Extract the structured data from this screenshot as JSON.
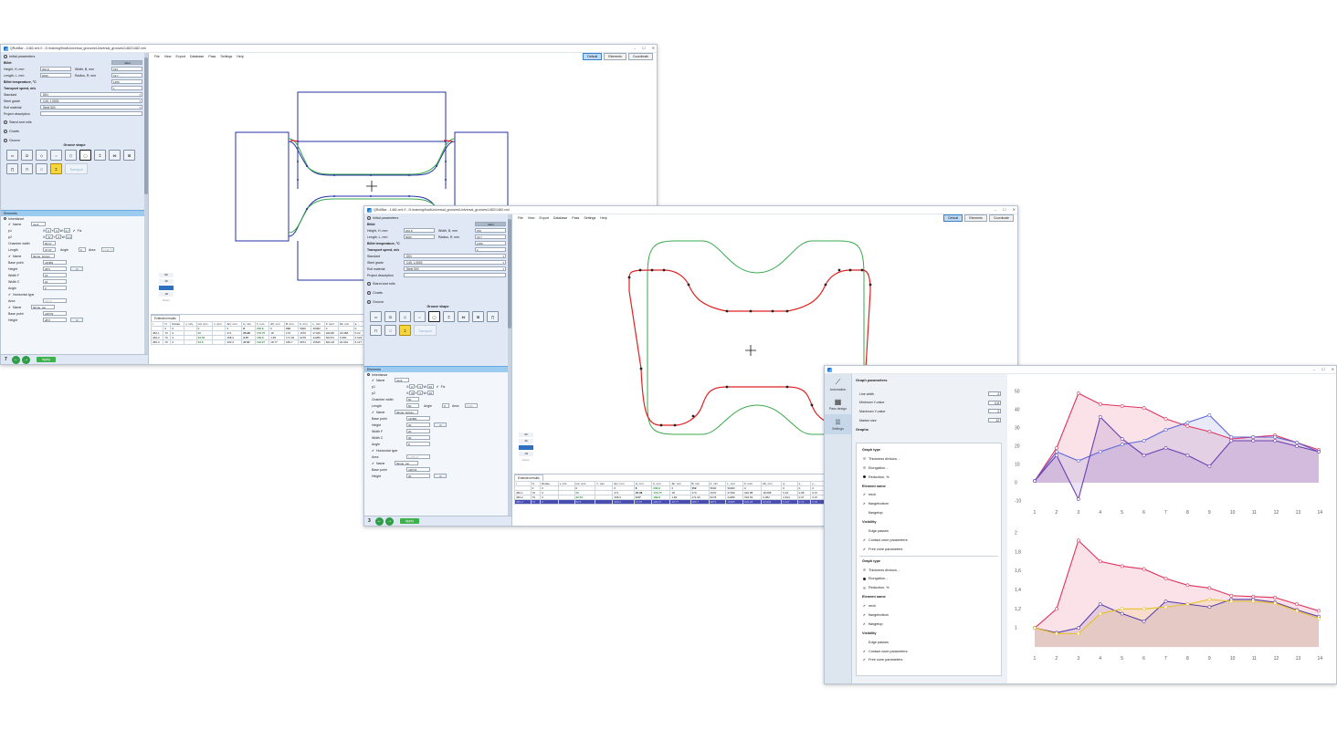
{
  "win1": {
    "title": "QRollBar - 1482.xml 0 - D:\\training\\final\\Universal_grooves\\Universal_grooves\\1482\\1482.xml",
    "menu": [
      "File",
      "View",
      "Export",
      "Database",
      "Pass",
      "Settings",
      "Help"
    ],
    "toolbar": [
      "Default",
      "Elements",
      "Coordinate"
    ],
    "initial": "Initial parameters",
    "billet": "Billet",
    "billet_tag": "label",
    "height_lbl": "Height, H, mm",
    "height_val": "202.8",
    "width_lbl": "Width, B, mm",
    "width_val": "152",
    "length_lbl": "Length, L, mm",
    "length_val": "5000",
    "radius_lbl": "Radius, R, mm",
    "radius_val": "19.7",
    "temp_lbl": "Billet temperature, °C",
    "temp_val": "1250",
    "speed_lbl": "Transport speed, m/s",
    "speed_val": "1",
    "standard_lbl": "Standard",
    "standard_val": "DIN",
    "steel_lbl": "Steel grade",
    "steel_val": "C45, 1.0503",
    "roll_lbl": "Roll material",
    "roll_val": "Steel 500",
    "desc_lbl": "Project description",
    "stand": "Stand and rolls",
    "charts": "Charts",
    "groove": "Groove",
    "groove_shape": "Groove shape",
    "transport": "Transport",
    "elements": "Elements",
    "inheritance": "Inheritance",
    "el_name_lbl": "Name",
    "el_name_val": "neck",
    "p1": "p1",
    "p2": "p2",
    "fix": "Fix",
    "chamber": "Chamber width",
    "chamber_val": "84.67",
    "len_lbl": "Length",
    "len_val": "37.97",
    "angle_lbl": "Angle",
    "area_lbl": "Area",
    "area_val": "1136.77",
    "el2_name": "flange_bottom",
    "base_lbl": "Base point",
    "base_val": "p2NB3",
    "height2_lbl": "Height",
    "height2_val": "28.5",
    "wf_lbl": "Width F",
    "wf_val": "15",
    "wc_lbl": "Width C",
    "wc_val": "22",
    "angle2_lbl": "Angle",
    "angle2_val": "0",
    "htype": "Horizontal type",
    "area2_lbl": "Area",
    "area2_val": "721.3",
    "el3_name": "flange_top",
    "base3_val": "p2PO3",
    "height3_val": "28.5",
    "c_btn": "C",
    "pass_no": "7",
    "apply": "Apply",
    "zoom": [
      "80",
      "40",
      "",
      "-40"
    ],
    "zoom_lbl": "Zoom",
    "results_tab": "Extended results",
    "results_head": [
      "i",
      "N",
      "Rotate",
      "v, m/s",
      "nst, rpm",
      "n, rpm",
      "Δm, mm",
      "H, mm",
      "h, mm",
      "Δh, mm",
      "B, mm",
      "b, mm",
      "L, mm",
      "F, mm²",
      "Dk, mm",
      "a, -",
      "λ, -",
      "γ, -"
    ],
    "results": [
      [
        "",
        "0",
        "0",
        "",
        "0",
        "",
        "0",
        "8",
        "202.8",
        "0",
        "152",
        "5000",
        "30482",
        "0",
        "",
        "0",
        "0",
        "0"
      ],
      [
        "450-1",
        "70",
        "0",
        "",
        "20",
        "",
        "271",
        "25.38",
        "179.75",
        "18",
        "170",
        "1570",
        "27346",
        "940.88",
        "18.088",
        "5.22",
        "0.08",
        "0.07"
      ],
      [
        "450-2",
        "70",
        "0",
        "",
        "32.52",
        "",
        "268.3",
        "3.57",
        "169.8",
        "1.83",
        "171.93",
        "6278",
        "24280",
        "603.53",
        "6.082",
        "4.624",
        "0.07",
        "0.07"
      ],
      [
        "450-3",
        "70",
        "0",
        "",
        "52.6",
        "",
        "403.3",
        "37.97",
        "118.27",
        "18.77",
        "189.7",
        "9874",
        "15625",
        "603.28",
        "20.004",
        "5.117",
        "0.16",
        "0.04"
      ]
    ]
  },
  "win2": {
    "title": "QRollBar - 1482.xml 0 - D:\\training\\final\\Universal_grooves\\Universal_grooves\\1482\\1482.xml",
    "menu": [
      "File",
      "View",
      "Export",
      "Database",
      "Pass",
      "Settings",
      "Help"
    ],
    "toolbar": [
      "Default",
      "Elements",
      "Coordinate"
    ],
    "initial": "Initial parameters",
    "billet": "Billet",
    "billet_tag": "label",
    "height_lbl": "Height, H, mm",
    "height_val": "202.8",
    "width_lbl": "Width, B, mm",
    "width_val": "152",
    "length_lbl": "Length, L, mm",
    "length_val": "5000",
    "radius_lbl": "Radius, R, mm",
    "radius_val": "19.7",
    "temp_lbl": "Billet temperature, °C",
    "temp_val": "1250",
    "speed_lbl": "Transport speed, m/s",
    "speed_val": "2",
    "standard_lbl": "Standard",
    "standard_val": "DIN",
    "steel_lbl": "Steel grade",
    "steel_val": "C45, 1.0503",
    "roll_lbl": "Roll material",
    "roll_val": "Steel 500",
    "desc_lbl": "Project description",
    "stand": "Stand and rolls",
    "charts": "Charts",
    "groove": "Groove",
    "groove_shape": "Groove shape",
    "transport": "Transport",
    "elements": "Elements",
    "inheritance": "Inheritance",
    "el_name_lbl": "Name",
    "el_name_val": "neck",
    "p1": "p1",
    "p2": "p2",
    "fix": "Fix",
    "chamber": "Chamber width",
    "chamber_val": "50",
    "len_lbl": "Length",
    "len_val": "50",
    "angle_lbl": "Angle",
    "area_lbl": "Area",
    "area_val": "1780",
    "el2_name": "flange_bottom",
    "base_lbl": "Base point",
    "base_val": "p2NB3",
    "height2_lbl": "Height",
    "height2_val": "30",
    "wf_lbl": "Width F",
    "wf_val": "20",
    "wc_lbl": "Width C",
    "wc_val": "30",
    "angle2_lbl": "Angle",
    "angle2_val": "8",
    "htype": "Horizontal type",
    "area2_lbl": "Area",
    "area2_val": "1,206.27",
    "el3_name": "flange_top",
    "base3_val": "p2PO3",
    "height3_val": "30",
    "c_btn": "C",
    "pass_no": "3",
    "apply": "Apply",
    "zoom": [
      "60",
      "40",
      "",
      "-40"
    ],
    "zoom_lbl": "Zoom",
    "results_tab": "Extended results",
    "results_head": [
      "i",
      "N",
      "Rotate",
      "v, m/s",
      "nst, rpm",
      "n, rpm",
      "Δm, mm",
      "H, mm",
      "h, mm",
      "Δh, mm",
      "B, mm",
      "b, mm",
      "L, mm",
      "F, mm²",
      "Dk, mm",
      "a, -",
      "λ, -",
      "γ, -"
    ],
    "results": [
      [
        "",
        "0",
        "0",
        "",
        "0",
        "",
        "0",
        "8",
        "202.8",
        "0",
        "152",
        "5000",
        "30482",
        "0",
        "",
        "0",
        "0",
        "0"
      ],
      [
        "450-1",
        "70",
        "0",
        "",
        "20",
        "",
        "271",
        "25.38",
        "179.75",
        "18",
        "170",
        "1570",
        "27346",
        "940.88",
        "18.088",
        "5.22",
        "0.08",
        "0.07"
      ],
      [
        "450-2",
        "70",
        "0",
        "",
        "32.52",
        "",
        "268.3",
        "3.57",
        "169.8",
        "1.83",
        "171.93",
        "6278",
        "24280",
        "603.53",
        "6.082",
        "4.624",
        "0.07",
        "0.07"
      ],
      [
        "450-3",
        "70",
        "0",
        "",
        "52.6",
        "",
        "403.3",
        "37.97",
        "118.27",
        "18.77",
        "189.7",
        "9874",
        "15625",
        "603.28",
        "20.004",
        "5.117",
        "0.16",
        "0.04"
      ]
    ]
  },
  "win3": {
    "side": [
      "Automation",
      "Pass design",
      "Settings"
    ],
    "gp_title": "Graph parameters",
    "params": [
      {
        "label": "Line width",
        "value": "3"
      },
      {
        "label": "Minimum Y-value",
        "value": "0,8"
      },
      {
        "label": "Maximum Y-value",
        "value": "2"
      },
      {
        "label": "Marker size",
        "value": "12"
      }
    ],
    "graphs": "Graphs",
    "g1": {
      "type_lbl": "Graph type",
      "types": [
        "Thickness division, -",
        "Elongation, -",
        "Reduction, %"
      ],
      "type_sel": 2,
      "el_lbl": "Element name",
      "elements": [
        "neck",
        "flangebottom",
        "flangetop"
      ],
      "el_checked": [
        true,
        true,
        false
      ],
      "vis_lbl": "Visibility",
      "vis": [
        "Edge passes",
        "Contact zone parameters",
        "Free zone parameters"
      ],
      "vis_checked": [
        false,
        true,
        true
      ]
    },
    "g2": {
      "type_lbl": "Graph type",
      "types": [
        "Thickness division, -",
        "Elongation, -",
        "Reduction, %"
      ],
      "type_sel": 1,
      "el_lbl": "Element name",
      "elements": [
        "neck",
        "flangebottom",
        "flangetop"
      ],
      "el_checked": [
        true,
        true,
        true
      ],
      "vis_lbl": "Visibility",
      "vis": [
        "Edge passes",
        "Contact zone parameters",
        "Free zone parameters"
      ],
      "vis_checked": [
        false,
        true,
        true
      ]
    }
  },
  "chart_data": [
    {
      "type": "area",
      "title": "",
      "x": [
        1,
        2,
        3,
        4,
        5,
        6,
        7,
        8,
        9,
        10,
        11,
        12,
        13,
        14
      ],
      "ylim": [
        -10,
        50
      ],
      "yticks": [
        "50",
        "40",
        "30",
        "20",
        "10",
        "0",
        "-10"
      ],
      "xticks": [
        "1",
        "2",
        "3",
        "4",
        "5",
        "6",
        "7",
        "8",
        "9",
        "10",
        "11",
        "12",
        "13",
        "14"
      ],
      "series": [
        {
          "values": [
            1,
            19,
            49,
            43,
            42,
            41,
            35,
            31,
            28,
            24,
            25,
            26,
            22,
            18
          ],
          "color": "#e0325f"
        },
        {
          "values": [
            1,
            17,
            12,
            17,
            21,
            23,
            29,
            33,
            37,
            25,
            25,
            25,
            22,
            17
          ],
          "color": "#5b66d6"
        },
        {
          "values": [
            1,
            15,
            -9,
            36,
            24,
            15,
            19,
            15,
            9,
            23,
            23,
            23,
            20,
            17
          ],
          "color": "#6a3fb1"
        }
      ]
    },
    {
      "type": "area",
      "title": "",
      "x": [
        1,
        2,
        3,
        4,
        5,
        6,
        7,
        8,
        9,
        10,
        11,
        12,
        13,
        14
      ],
      "ylim": [
        0.8,
        2
      ],
      "yticks": [
        "2",
        "1,8",
        "1,6",
        "1,4",
        "1,2",
        "1"
      ],
      "xticks": [
        "1",
        "2",
        "3",
        "4",
        "5",
        "6",
        "7",
        "8",
        "9",
        "10",
        "11",
        "12",
        "13",
        "14"
      ],
      "series": [
        {
          "values": [
            1,
            1.2,
            1.92,
            1.7,
            1.65,
            1.62,
            1.52,
            1.45,
            1.42,
            1.34,
            1.33,
            1.32,
            1.25,
            1.18
          ],
          "color": "#e0325f"
        },
        {
          "values": [
            1,
            0.95,
            1.0,
            1.25,
            1.15,
            1.07,
            1.28,
            1.25,
            1.22,
            1.3,
            1.3,
            1.27,
            1.19,
            1.12
          ],
          "color": "#5b3ea6"
        },
        {
          "values": [
            1,
            0.94,
            0.94,
            1.15,
            1.2,
            1.2,
            1.22,
            1.25,
            1.3,
            1.28,
            1.28,
            1.26,
            1.18,
            1.1
          ],
          "color": "#e8c227"
        }
      ]
    }
  ]
}
